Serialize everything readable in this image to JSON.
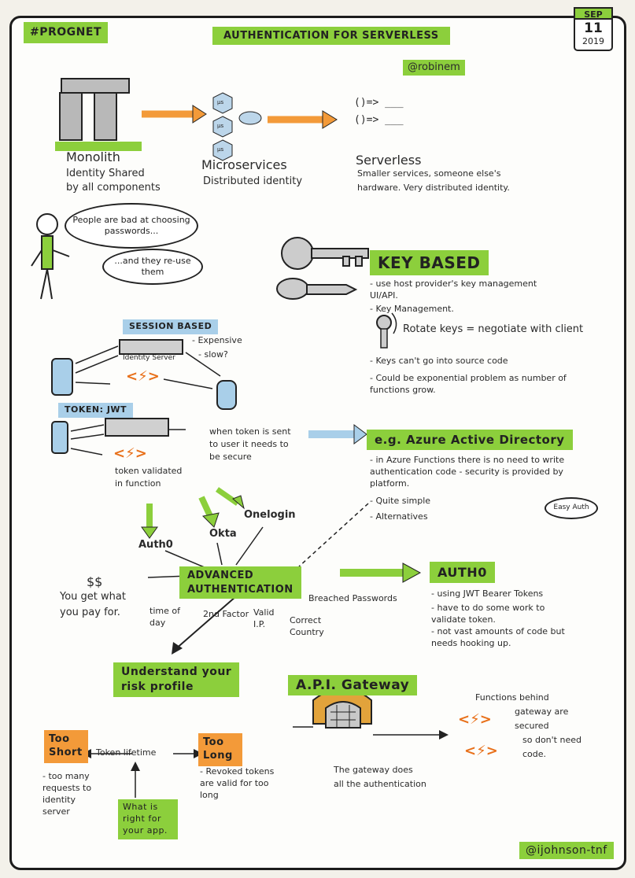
{
  "header": {
    "hashtag": "#PROGNET",
    "title": "AUTHENTICATION FOR SERVERLESS",
    "handle_top": "@robinem",
    "date": {
      "month": "SEP",
      "day": "11",
      "year": "2019"
    }
  },
  "architectures": {
    "monolith": {
      "title": "Monolith",
      "desc_1": "Identity Shared",
      "desc_2": "by all components"
    },
    "microservices": {
      "title": "Microservices",
      "desc": "Distributed identity",
      "nodes": [
        "µs",
        "µs",
        "µs"
      ]
    },
    "serverless": {
      "title": "Serverless",
      "code_1": "()=> ___",
      "code_2": "()=> ___",
      "desc_1": "Smaller services, someone else's",
      "desc_2": "hardware. Very distributed identity."
    }
  },
  "speech": {
    "bubble_1": "People are bad at choosing passwords...",
    "bubble_2": "...and they re-use them"
  },
  "key_based": {
    "title": "KEY BASED",
    "points": [
      "- use host provider's key management UI/API.",
      "- Key Management.",
      "Rotate keys = negotiate with client",
      "- Keys can't go into source code",
      "- Could be exponential problem as number of functions grow."
    ]
  },
  "session_based": {
    "title": "SESSION BASED",
    "server_label": "Identity Server",
    "note_1": "- Expensive",
    "note_2": "- slow?"
  },
  "token_jwt": {
    "title": "TOKEN: JWT",
    "note_1": "token validated",
    "note_2": "in function",
    "secure_1": "when token is sent",
    "secure_2": "to user it needs to",
    "secure_3": "be secure"
  },
  "azure": {
    "title": "e.g. Azure Active Directory",
    "points": [
      "- in Azure Functions there is no need to write authentication code - security is provided by platform.",
      "- Quite simple",
      "- Alternatives"
    ],
    "easy_auth": "Easy Auth"
  },
  "providers": {
    "auth0": "Auth0",
    "okta": "Okta",
    "onelogin": "Onelogin"
  },
  "advanced": {
    "title_1": "ADVANCED",
    "title_2": "AUTHENTICATION",
    "money": "$$",
    "pay_1": "You get what",
    "pay_2": "you pay for.",
    "factors": [
      "time of day",
      "2nd Factor",
      "Valid I.P.",
      "Correct Country",
      "Breached Passwords"
    ]
  },
  "auth0_box": {
    "title": "AUTH0",
    "points": [
      "- using JWT Bearer Tokens",
      "- have to do some work to validate token.",
      "- not vast amounts of code but needs hooking up."
    ]
  },
  "risk": {
    "title_1": "Understand your",
    "title_2": "risk profile"
  },
  "api_gateway": {
    "title": "A.P.I. Gateway",
    "desc_1": "The gateway does",
    "desc_2": "all the authentication",
    "right_1": "Functions behind",
    "right_2": "gateway are",
    "right_3": "secured",
    "right_4": "so don't need",
    "right_5": "code."
  },
  "token_lifetime": {
    "label": "Token lifetime",
    "too_short": "Too Short",
    "too_long": "Too Long",
    "short_note": "- too many requests to identity server",
    "long_note": "- Revoked tokens are valid for too long",
    "right_question": "What is right for your app."
  },
  "footer": {
    "handle": "@ijohnson-tnf"
  },
  "colors": {
    "green": "#8ccf3c",
    "orange": "#f39a39",
    "blue": "#a9cfe9"
  }
}
